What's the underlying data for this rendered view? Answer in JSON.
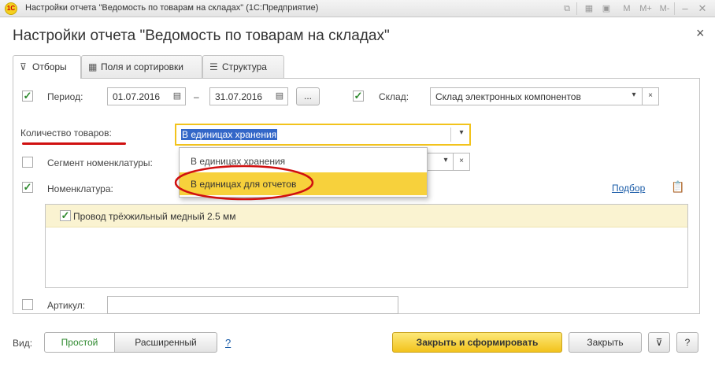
{
  "window": {
    "title": "Настройки отчета \"Ведомость по товарам на складах\"  (1С:Предприятие)",
    "logo_text": "1С",
    "toolbar_labels": {
      "m": "M",
      "m_plus": "M+",
      "m_minus": "M-"
    }
  },
  "form": {
    "title": "Настройки отчета \"Ведомость по товарам на складах\""
  },
  "tabs": [
    {
      "label": "Отборы",
      "active": true
    },
    {
      "label": "Поля и сортировки",
      "active": false
    },
    {
      "label": "Структура",
      "active": false
    }
  ],
  "filters": {
    "period": {
      "label": "Период:",
      "checked": true,
      "date_from": "01.07.2016",
      "separator": "–",
      "date_to": "31.07.2016",
      "more_label": "..."
    },
    "warehouse": {
      "label": "Склад:",
      "checked": true,
      "value": "Склад электронных компонентов"
    },
    "quantity": {
      "label": "Количество товаров:",
      "value": "В единицах хранения",
      "options": [
        "В единицах хранения",
        "В единицах для отчетов"
      ],
      "highlighted_option": "В единицах для отчетов"
    },
    "segment": {
      "label": "Сегмент номенклатуры:",
      "checked": false
    },
    "nomenclature": {
      "label": "Номенклатура:",
      "checked": true,
      "pick_link": "Подбор",
      "items": [
        {
          "name": "Провод трёхжильный медный 2.5 мм",
          "checked": true
        }
      ]
    },
    "article": {
      "label": "Артикул:",
      "checked": false,
      "value": ""
    }
  },
  "footer": {
    "view_label": "Вид:",
    "simple_label": "Простой",
    "extended_label": "Расширенный",
    "help_link": "?",
    "generate_label": "Закрыть и сформировать",
    "close_label": "Закрыть",
    "help_label": "?"
  },
  "colors": {
    "accent_yellow": "#f7d13c",
    "check_green": "#2f8a2f",
    "annotation_red": "#d01010",
    "link_blue": "#1a5ca8"
  }
}
